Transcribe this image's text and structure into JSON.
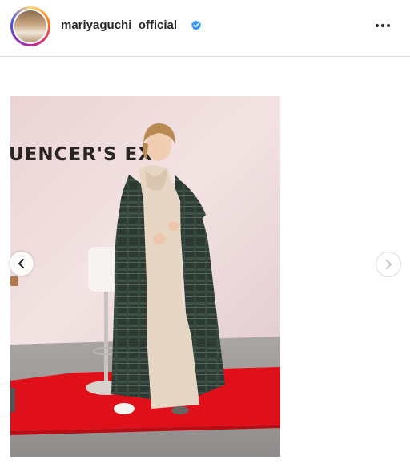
{
  "post": {
    "username": "mariyaguchi_official",
    "verified": true,
    "icons": {
      "verified": "verified-badge-icon",
      "more": "more-options-icon",
      "prev": "chevron-left-icon",
      "next": "chevron-right-icon"
    },
    "photo": {
      "backdrop_text": "UENCER'S   EX"
    }
  },
  "colors": {
    "verified_blue": "#3897f0",
    "stage_red": "#e0101a",
    "border": "#dbdbdb"
  }
}
